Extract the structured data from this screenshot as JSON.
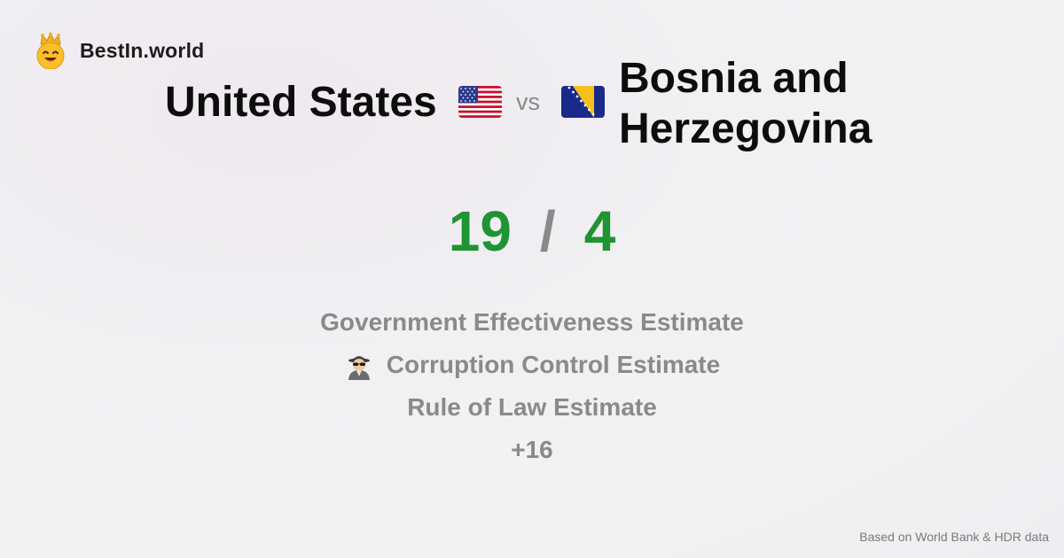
{
  "brand": {
    "name": "BestIn.world",
    "logo_icon": "crowned-smiley-icon"
  },
  "comparison": {
    "left_country": "United States",
    "left_flag": "us-flag-icon",
    "vs_label": "vs",
    "right_country": "Bosnia and Herzegovina",
    "right_flag": "bosnia-flag-icon"
  },
  "score": {
    "left": "19",
    "separator": "/",
    "right": "4",
    "color": "#1e9433"
  },
  "metrics": [
    {
      "label": "Government Effectiveness Estimate",
      "icon": ""
    },
    {
      "label": "Corruption Control Estimate",
      "icon": "spy-icon"
    },
    {
      "label": "Rule of Law Estimate",
      "icon": ""
    },
    {
      "label": "+16",
      "icon": ""
    }
  ],
  "footer": {
    "source": "Based on World Bank & HDR data"
  }
}
